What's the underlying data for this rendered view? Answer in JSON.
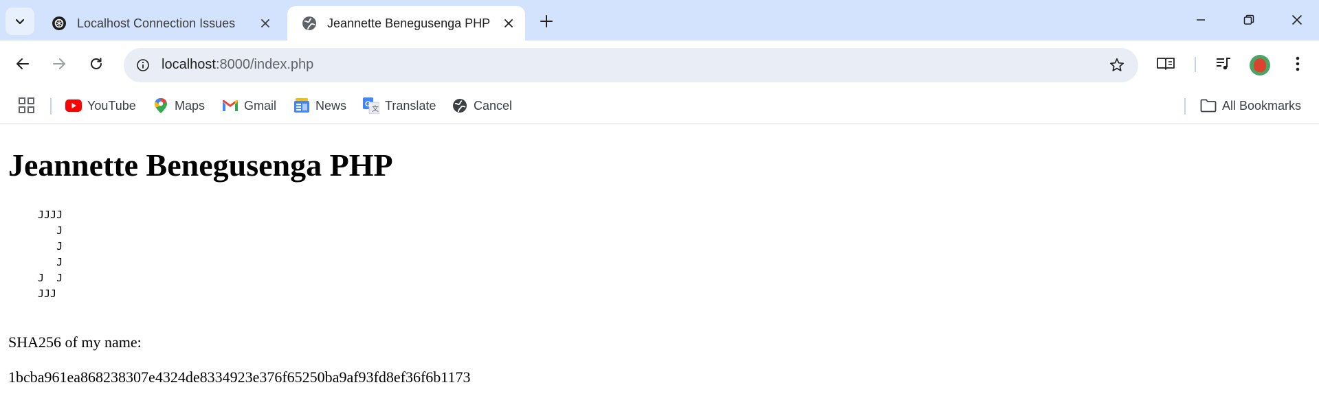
{
  "browser": {
    "tabs": [
      {
        "title": "Localhost Connection Issues",
        "active": false,
        "favicon": "openai-icon"
      },
      {
        "title": "Jeannette Benegusenga PHP",
        "active": true,
        "favicon": "globe-icon"
      }
    ],
    "address_bar": {
      "host": "localhost",
      "path": ":8000/index.php"
    },
    "bookmarks": [
      {
        "label": "YouTube",
        "icon": "youtube-icon"
      },
      {
        "label": "Maps",
        "icon": "maps-icon"
      },
      {
        "label": "Gmail",
        "icon": "gmail-icon"
      },
      {
        "label": "News",
        "icon": "news-icon"
      },
      {
        "label": "Translate",
        "icon": "translate-icon"
      },
      {
        "label": "Cancel",
        "icon": "globe-icon"
      }
    ],
    "all_bookmarks_label": "All Bookmarks",
    "accent_color": "#d3e3fd"
  },
  "page": {
    "heading": "Jeannette Benegusenga PHP",
    "ascii_art": "JJJJ\n   J\n   J\n   J\nJ  J\nJJJ",
    "sha_label": "SHA256 of my name:",
    "sha_value": "1bcba961ea868238307e4324de8334923e376f65250ba9af93fd8ef36f6b1173"
  }
}
